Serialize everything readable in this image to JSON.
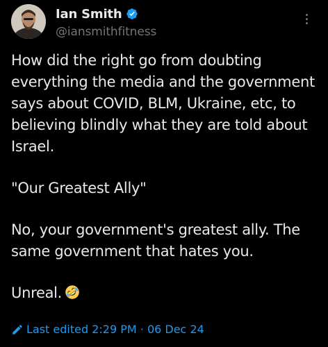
{
  "post": {
    "author": {
      "display_name": "Ian Smith",
      "handle": "@iansmithfitness",
      "verified_icon": "verified-badge-icon",
      "avatar_icon": "avatar"
    },
    "more_icon": "more-options-icon",
    "paragraphs": [
      "How did the right go from doubting everything the media and the government says about COVID, BLM, Ukraine, etc, to believing blindly what they are told about Israel.",
      "\"Our Greatest Ally\"",
      "No, your government's greatest ally. The same government that hates you.",
      "Unreal."
    ],
    "closing_emoji": "rolling-on-floor-laughing-emoji",
    "edited": {
      "label": "Last edited 2:29 PM · 06 Dec 24",
      "icon": "pencil-icon"
    }
  },
  "colors": {
    "background": "#000000",
    "text_primary": "#e7e9ea",
    "text_secondary": "#71767b",
    "accent": "#1d9bf0"
  }
}
